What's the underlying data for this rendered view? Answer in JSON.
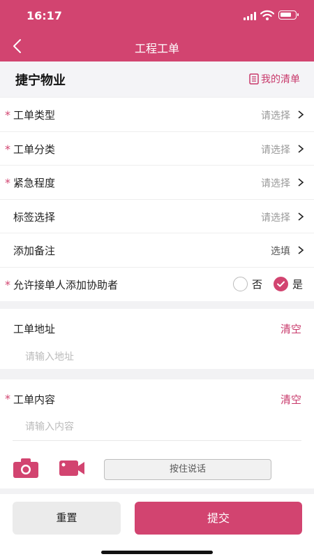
{
  "status_bar": {
    "time": "16:17"
  },
  "nav": {
    "title": "工程工单"
  },
  "company": {
    "name": "捷宁物业",
    "my_list": "我的清单"
  },
  "form_rows": [
    {
      "label": "工单类型",
      "required": true,
      "value": "请选择"
    },
    {
      "label": "工单分类",
      "required": true,
      "value": "请选择"
    },
    {
      "label": "紧急程度",
      "required": true,
      "value": "请选择"
    },
    {
      "label": "标签选择",
      "required": false,
      "value": "请选择"
    },
    {
      "label": "添加备注",
      "required": false,
      "value": "选填"
    }
  ],
  "helper_row": {
    "label": "允许接单人添加协助者",
    "required": true,
    "option_no": "否",
    "option_yes": "是",
    "selected": "是"
  },
  "address": {
    "label": "工单地址",
    "clear": "清空",
    "placeholder": "请输入地址"
  },
  "content": {
    "label": "工单内容",
    "clear": "清空",
    "placeholder": "请输入内容",
    "voice_label": "按住说话"
  },
  "actions": {
    "reset": "重置",
    "submit": "提交"
  },
  "required_mark": "*",
  "colors": {
    "brand": "#d24470",
    "accent_text": "#c8396b"
  },
  "icons": [
    "back-icon",
    "list-icon",
    "chevron-right-icon",
    "check-icon",
    "camera-icon",
    "video-icon"
  ]
}
